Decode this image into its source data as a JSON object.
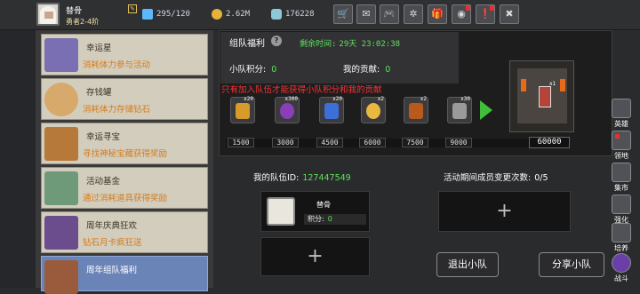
{
  "user": {
    "name": "替骨",
    "title": "勇者2-4阶"
  },
  "resources": [
    {
      "icon": "stamina-icon",
      "value": "295/120"
    },
    {
      "icon": "gold-coin-icon",
      "value": "2.62M"
    },
    {
      "icon": "diamond-icon",
      "value": "176228"
    }
  ],
  "toolbar": [
    {
      "icon": "shop-icon",
      "glyph": "🛒"
    },
    {
      "icon": "mail-icon",
      "glyph": "✉"
    },
    {
      "icon": "gamepad-icon",
      "glyph": "🎮"
    },
    {
      "icon": "settings-gear-icon",
      "glyph": "✲"
    },
    {
      "icon": "gift-icon",
      "glyph": "🎁"
    },
    {
      "icon": "color-wheel-icon",
      "glyph": "◉"
    },
    {
      "icon": "event-icon",
      "glyph": "❗"
    },
    {
      "icon": "tools-icon",
      "glyph": "✖"
    }
  ],
  "events": [
    {
      "title": "幸运星",
      "desc": "消耗体力参与活动",
      "icon": "lucky-star-icon",
      "color": "#7a6fb3"
    },
    {
      "title": "存钱罐",
      "desc": "消耗体力存储钻石",
      "icon": "piggy-bank-icon",
      "color": "#d7a96a"
    },
    {
      "title": "幸运寻宝",
      "desc": "寻找神秘宝藏获得奖励",
      "icon": "treasure-hunt-icon",
      "color": "#b7793a"
    },
    {
      "title": "活动基金",
      "desc": "通过消耗道具获得奖励",
      "icon": "fund-bag-icon",
      "color": "#6f9a7a"
    },
    {
      "title": "周年庆典狂欢",
      "desc": "钻石月卡疯狂送",
      "icon": "anniversary-icon",
      "color": "#6b4c8c"
    },
    {
      "title": "周年组队福利",
      "desc": "",
      "icon": "team-welfare-icon",
      "color": "#9a5a3c"
    }
  ],
  "panel": {
    "title": "组队福利",
    "timer_label": "剩余时间:",
    "timer_value": "29天 23:02:38",
    "team_points_label": "小队积分:",
    "team_points_value": "0",
    "my_contribution_label": "我的贡献:",
    "my_contribution_value": "0",
    "warning": "只有加入队伍才能获得小队积分和我的贡献",
    "rewards": [
      {
        "count": "x20",
        "icon": "lightning-scroll-icon",
        "color": "#d89a28"
      },
      {
        "count": "x300",
        "icon": "purple-orb-icon",
        "color": "#8a3fb8"
      },
      {
        "count": "x20",
        "icon": "blue-gem-icon",
        "color": "#3c6fd8"
      },
      {
        "count": "x2",
        "icon": "golden-egg-icon",
        "color": "#e8b840"
      },
      {
        "count": "x2",
        "icon": "torch-icon",
        "color": "#b85a1c"
      },
      {
        "count": "x30",
        "icon": "hammer-icon",
        "color": "#9a9a9a"
      }
    ],
    "milestones": [
      "1500",
      "3000",
      "4500",
      "6000",
      "7500",
      "9000"
    ],
    "milestone_max": "60000",
    "progress": 0,
    "scene_tag": "x1"
  },
  "team": {
    "id_label": "我的队伍ID:",
    "id_value": "127447549",
    "changes_label": "活动期间成员变更次数:",
    "changes_value": "0/5",
    "member_name": "替骨",
    "member_score_label": "积分:",
    "member_score_value": "0",
    "add_glyph": "+",
    "leave_label": "退出小队",
    "share_label": "分享小队"
  },
  "rail": [
    {
      "label": "英雄",
      "icon": "hero-icon"
    },
    {
      "label": "领地",
      "icon": "territory-icon"
    },
    {
      "label": "集市",
      "icon": "market-icon"
    },
    {
      "label": "强化",
      "icon": "enhance-icon"
    },
    {
      "label": "培养",
      "icon": "train-icon"
    },
    {
      "label": "战斗",
      "icon": "battle-icon"
    }
  ]
}
